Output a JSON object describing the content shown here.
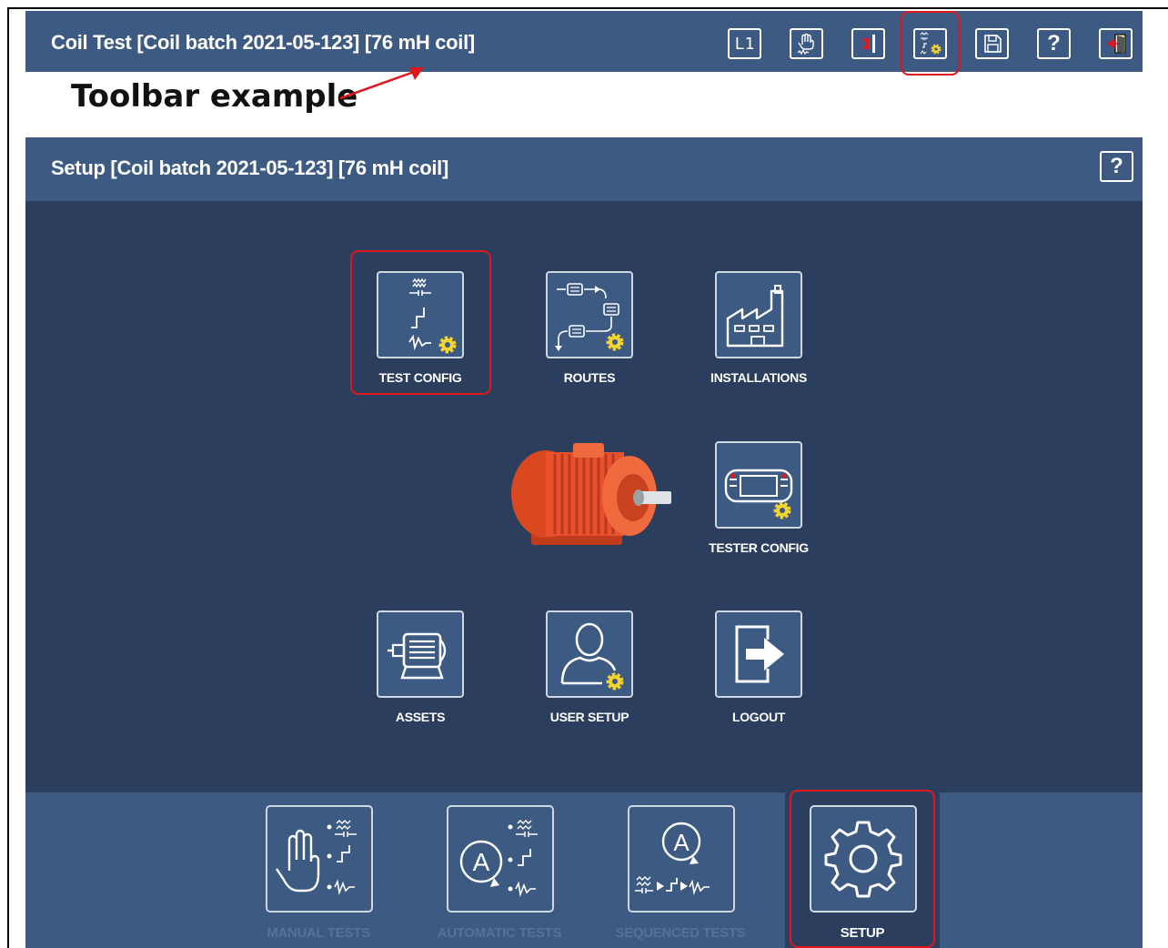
{
  "toolbar": {
    "title": "Coil Test  [Coil batch 2021-05-123] [76 mH coil]",
    "buttons": [
      {
        "name": "l1-button",
        "text": "L1"
      },
      {
        "name": "manual-test-button",
        "icon": "hand-waveform-icon"
      },
      {
        "name": "marker-button",
        "icon": "red-marker-icon"
      },
      {
        "name": "test-config-button",
        "icon": "test-config-gear-icon"
      },
      {
        "name": "save-button",
        "icon": "floppy-disk-icon"
      },
      {
        "name": "help-button",
        "text": "?"
      },
      {
        "name": "exit-button",
        "icon": "exit-door-icon"
      }
    ]
  },
  "annotation": {
    "text": "Toolbar example"
  },
  "setup_header": {
    "title": "Setup  [Coil batch 2021-05-123] [76 mH coil]",
    "help": "?"
  },
  "tiles": {
    "test_config": "TEST CONFIG",
    "routes": "ROUTES",
    "installations": "INSTALLATIONS",
    "tester_config": "TESTER CONFIG",
    "assets": "ASSETS",
    "user_setup": "USER SETUP",
    "logout": "LOGOUT"
  },
  "bottom_nav": {
    "manual": "MANUAL TESTS",
    "automatic": "AUTOMATIC TESTS",
    "sequenced": "SEQUENCED TESTS",
    "setup": "SETUP"
  },
  "colors": {
    "header_bg": "#3d5a83",
    "main_bg": "#2c3e5e",
    "highlight": "#e0161c",
    "gear": "#f3d32f",
    "motor": "#e8502e"
  }
}
